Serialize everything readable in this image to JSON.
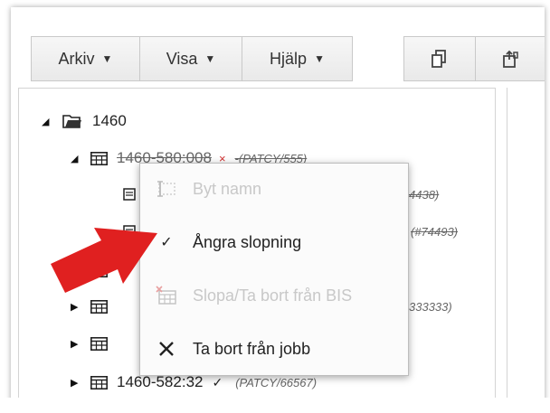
{
  "toolbar": {
    "menus": [
      {
        "label": "Arkiv"
      },
      {
        "label": "Visa"
      },
      {
        "label": "Hjälp"
      }
    ],
    "icons": [
      "copy-icon",
      "share-icon"
    ]
  },
  "tree": {
    "root": {
      "label": "1460",
      "icon": "folder-open-icon"
    },
    "rows": [
      {
        "label": "1460-580:008",
        "status": "×",
        "meta": "-(PATCY/555)",
        "struck": true
      },
      {
        "label": "",
        "meta": "4438)",
        "struck": true
      },
      {
        "label": "",
        "meta": "(#74493)",
        "struck": true
      },
      {
        "label": "",
        "meta": ""
      },
      {
        "label": "",
        "meta": "333333)"
      },
      {
        "label": "",
        "meta": ""
      },
      {
        "label": "1460-582:32",
        "status": "✓",
        "meta": "(PATCY/66567)"
      }
    ]
  },
  "context_menu": {
    "items": [
      {
        "label": "Byt namn",
        "enabled": false,
        "icon": "rename-icon"
      },
      {
        "label": "Ångra slopning",
        "enabled": true,
        "icon": "check-icon"
      },
      {
        "label": "Slopa/Ta bort från BIS",
        "enabled": false,
        "icon": "delete-table-icon"
      },
      {
        "label": "Ta bort från jobb",
        "enabled": true,
        "icon": "close-icon"
      }
    ]
  },
  "colors": {
    "accent_arrow": "#e02020",
    "disabled_text": "#c8c8c8"
  }
}
